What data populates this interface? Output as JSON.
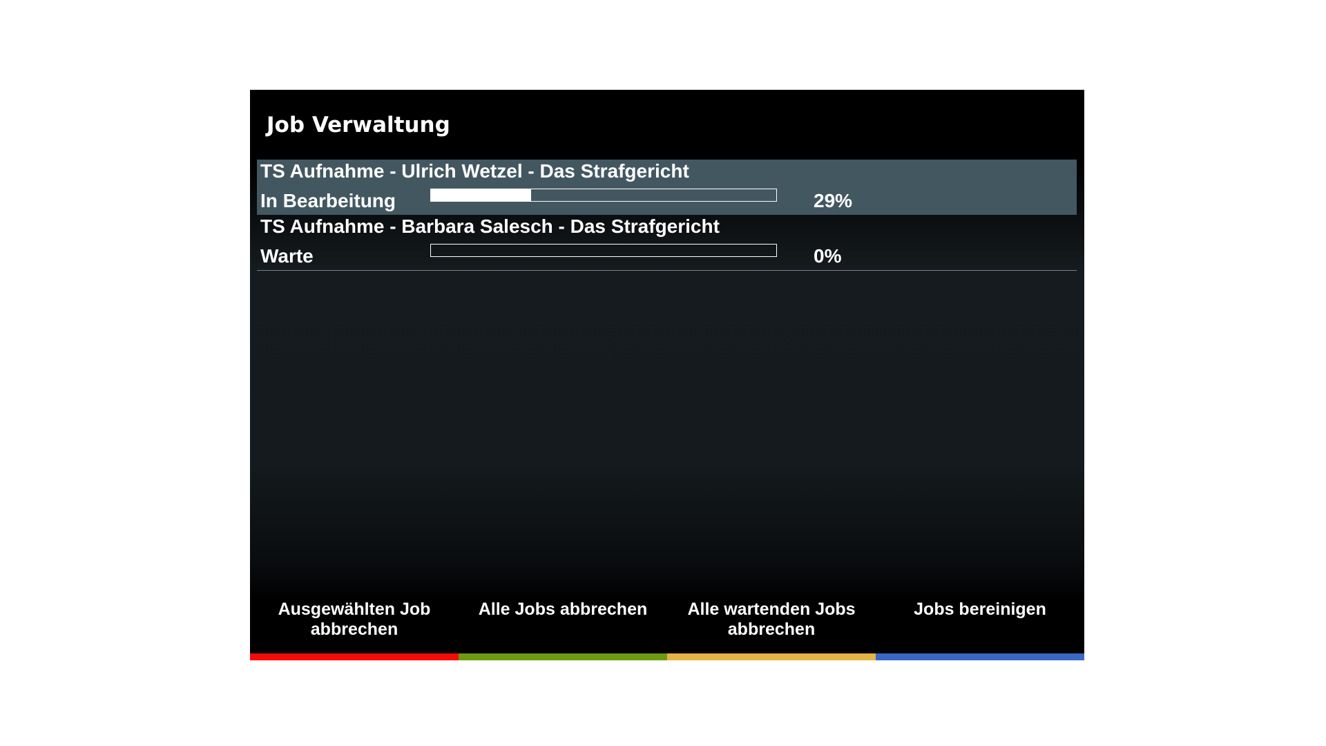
{
  "window": {
    "title": "Job Verwaltung"
  },
  "jobs": [
    {
      "name": "TS Aufnahme - Ulrich Wetzel - Das Strafgericht",
      "status": "In Bearbeitung",
      "progress_percent": 29,
      "progress_label": "29%",
      "selected": true
    },
    {
      "name": "TS Aufnahme - Barbara Salesch - Das Strafgericht",
      "status": "Warte",
      "progress_percent": 0,
      "progress_label": "0%",
      "selected": false
    }
  ],
  "buttons": [
    {
      "label": "Ausgewählten Job abbrechen",
      "color_name": "red",
      "color": "#f90a0a"
    },
    {
      "label": "Alle Jobs abbrechen",
      "color_name": "green",
      "color": "#6f9a10"
    },
    {
      "label": "Alle wartenden Jobs abbrechen",
      "color_name": "yellow",
      "color": "#e6b445"
    },
    {
      "label": "Jobs bereinigen",
      "color_name": "blue",
      "color": "#3a69c4"
    }
  ],
  "colors": {
    "selection": "#435761",
    "background": "#000000",
    "text": "#ffffff"
  }
}
